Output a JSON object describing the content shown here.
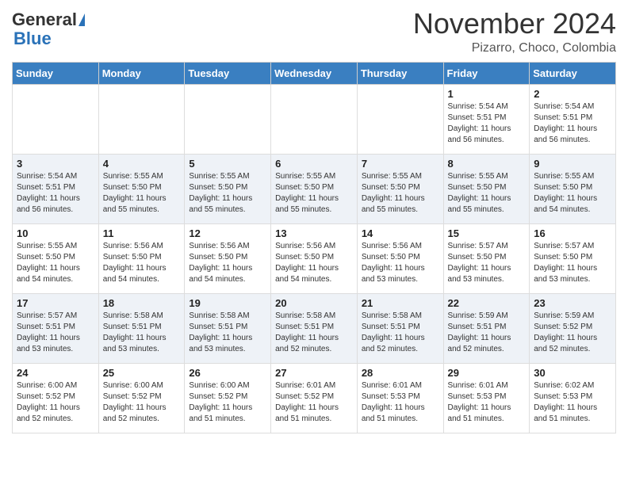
{
  "logo": {
    "general": "General",
    "blue": "Blue"
  },
  "header": {
    "month": "November 2024",
    "location": "Pizarro, Choco, Colombia"
  },
  "weekdays": [
    "Sunday",
    "Monday",
    "Tuesday",
    "Wednesday",
    "Thursday",
    "Friday",
    "Saturday"
  ],
  "weeks": [
    [
      {
        "day": "",
        "sunrise": "",
        "sunset": "",
        "daylight": ""
      },
      {
        "day": "",
        "sunrise": "",
        "sunset": "",
        "daylight": ""
      },
      {
        "day": "",
        "sunrise": "",
        "sunset": "",
        "daylight": ""
      },
      {
        "day": "",
        "sunrise": "",
        "sunset": "",
        "daylight": ""
      },
      {
        "day": "",
        "sunrise": "",
        "sunset": "",
        "daylight": ""
      },
      {
        "day": "1",
        "sunrise": "Sunrise: 5:54 AM",
        "sunset": "Sunset: 5:51 PM",
        "daylight": "Daylight: 11 hours and 56 minutes."
      },
      {
        "day": "2",
        "sunrise": "Sunrise: 5:54 AM",
        "sunset": "Sunset: 5:51 PM",
        "daylight": "Daylight: 11 hours and 56 minutes."
      }
    ],
    [
      {
        "day": "3",
        "sunrise": "Sunrise: 5:54 AM",
        "sunset": "Sunset: 5:51 PM",
        "daylight": "Daylight: 11 hours and 56 minutes."
      },
      {
        "day": "4",
        "sunrise": "Sunrise: 5:55 AM",
        "sunset": "Sunset: 5:50 PM",
        "daylight": "Daylight: 11 hours and 55 minutes."
      },
      {
        "day": "5",
        "sunrise": "Sunrise: 5:55 AM",
        "sunset": "Sunset: 5:50 PM",
        "daylight": "Daylight: 11 hours and 55 minutes."
      },
      {
        "day": "6",
        "sunrise": "Sunrise: 5:55 AM",
        "sunset": "Sunset: 5:50 PM",
        "daylight": "Daylight: 11 hours and 55 minutes."
      },
      {
        "day": "7",
        "sunrise": "Sunrise: 5:55 AM",
        "sunset": "Sunset: 5:50 PM",
        "daylight": "Daylight: 11 hours and 55 minutes."
      },
      {
        "day": "8",
        "sunrise": "Sunrise: 5:55 AM",
        "sunset": "Sunset: 5:50 PM",
        "daylight": "Daylight: 11 hours and 55 minutes."
      },
      {
        "day": "9",
        "sunrise": "Sunrise: 5:55 AM",
        "sunset": "Sunset: 5:50 PM",
        "daylight": "Daylight: 11 hours and 54 minutes."
      }
    ],
    [
      {
        "day": "10",
        "sunrise": "Sunrise: 5:55 AM",
        "sunset": "Sunset: 5:50 PM",
        "daylight": "Daylight: 11 hours and 54 minutes."
      },
      {
        "day": "11",
        "sunrise": "Sunrise: 5:56 AM",
        "sunset": "Sunset: 5:50 PM",
        "daylight": "Daylight: 11 hours and 54 minutes."
      },
      {
        "day": "12",
        "sunrise": "Sunrise: 5:56 AM",
        "sunset": "Sunset: 5:50 PM",
        "daylight": "Daylight: 11 hours and 54 minutes."
      },
      {
        "day": "13",
        "sunrise": "Sunrise: 5:56 AM",
        "sunset": "Sunset: 5:50 PM",
        "daylight": "Daylight: 11 hours and 54 minutes."
      },
      {
        "day": "14",
        "sunrise": "Sunrise: 5:56 AM",
        "sunset": "Sunset: 5:50 PM",
        "daylight": "Daylight: 11 hours and 53 minutes."
      },
      {
        "day": "15",
        "sunrise": "Sunrise: 5:57 AM",
        "sunset": "Sunset: 5:50 PM",
        "daylight": "Daylight: 11 hours and 53 minutes."
      },
      {
        "day": "16",
        "sunrise": "Sunrise: 5:57 AM",
        "sunset": "Sunset: 5:50 PM",
        "daylight": "Daylight: 11 hours and 53 minutes."
      }
    ],
    [
      {
        "day": "17",
        "sunrise": "Sunrise: 5:57 AM",
        "sunset": "Sunset: 5:51 PM",
        "daylight": "Daylight: 11 hours and 53 minutes."
      },
      {
        "day": "18",
        "sunrise": "Sunrise: 5:58 AM",
        "sunset": "Sunset: 5:51 PM",
        "daylight": "Daylight: 11 hours and 53 minutes."
      },
      {
        "day": "19",
        "sunrise": "Sunrise: 5:58 AM",
        "sunset": "Sunset: 5:51 PM",
        "daylight": "Daylight: 11 hours and 53 minutes."
      },
      {
        "day": "20",
        "sunrise": "Sunrise: 5:58 AM",
        "sunset": "Sunset: 5:51 PM",
        "daylight": "Daylight: 11 hours and 52 minutes."
      },
      {
        "day": "21",
        "sunrise": "Sunrise: 5:58 AM",
        "sunset": "Sunset: 5:51 PM",
        "daylight": "Daylight: 11 hours and 52 minutes."
      },
      {
        "day": "22",
        "sunrise": "Sunrise: 5:59 AM",
        "sunset": "Sunset: 5:51 PM",
        "daylight": "Daylight: 11 hours and 52 minutes."
      },
      {
        "day": "23",
        "sunrise": "Sunrise: 5:59 AM",
        "sunset": "Sunset: 5:52 PM",
        "daylight": "Daylight: 11 hours and 52 minutes."
      }
    ],
    [
      {
        "day": "24",
        "sunrise": "Sunrise: 6:00 AM",
        "sunset": "Sunset: 5:52 PM",
        "daylight": "Daylight: 11 hours and 52 minutes."
      },
      {
        "day": "25",
        "sunrise": "Sunrise: 6:00 AM",
        "sunset": "Sunset: 5:52 PM",
        "daylight": "Daylight: 11 hours and 52 minutes."
      },
      {
        "day": "26",
        "sunrise": "Sunrise: 6:00 AM",
        "sunset": "Sunset: 5:52 PM",
        "daylight": "Daylight: 11 hours and 51 minutes."
      },
      {
        "day": "27",
        "sunrise": "Sunrise: 6:01 AM",
        "sunset": "Sunset: 5:52 PM",
        "daylight": "Daylight: 11 hours and 51 minutes."
      },
      {
        "day": "28",
        "sunrise": "Sunrise: 6:01 AM",
        "sunset": "Sunset: 5:53 PM",
        "daylight": "Daylight: 11 hours and 51 minutes."
      },
      {
        "day": "29",
        "sunrise": "Sunrise: 6:01 AM",
        "sunset": "Sunset: 5:53 PM",
        "daylight": "Daylight: 11 hours and 51 minutes."
      },
      {
        "day": "30",
        "sunrise": "Sunrise: 6:02 AM",
        "sunset": "Sunset: 5:53 PM",
        "daylight": "Daylight: 11 hours and 51 minutes."
      }
    ]
  ]
}
